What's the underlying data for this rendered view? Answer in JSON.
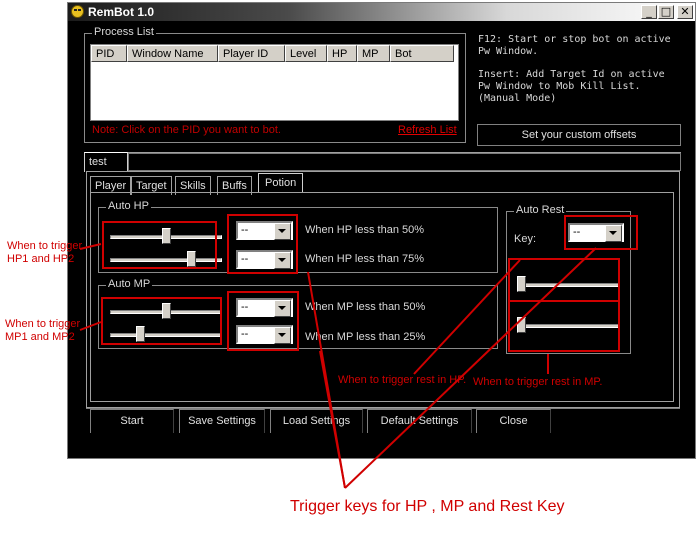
{
  "window": {
    "title": "RemBot 1.0",
    "controls": {
      "minimize": "_",
      "maximize": "□",
      "close": "✕"
    }
  },
  "process_list": {
    "label": "Process List",
    "columns": [
      "PID",
      "Window Name",
      "Player ID",
      "Level",
      "HP",
      "MP",
      "Bot"
    ],
    "note": "Note: Click on the PID you want to bot.",
    "refresh_link": "Refresh List"
  },
  "info": {
    "f12": "F12: Start or stop bot on active\nPw Window.",
    "insert": "Insert: Add Target Id on active\nPw Window to Mob Kill List.\n(Manual Mode)"
  },
  "custom_offsets_button": "Set your custom offsets",
  "profile_tab": "test",
  "tabs": [
    "Player",
    "Target",
    "Skills",
    "Buffs",
    "Potion"
  ],
  "selected_tab": "Potion",
  "auto_hp": {
    "label": "Auto HP",
    "rows": [
      {
        "combo_value": "--",
        "text": "When HP less than 50%",
        "slider": 0.5
      },
      {
        "combo_value": "--",
        "text": "When HP less than 75%",
        "slider": 0.75
      }
    ]
  },
  "auto_mp": {
    "label": "Auto MP",
    "rows": [
      {
        "combo_value": "--",
        "text": "When MP less than 50%",
        "slider": 0.5
      },
      {
        "combo_value": "--",
        "text": "When MP less than 25%",
        "slider": 0.25
      }
    ]
  },
  "auto_rest": {
    "label": "Auto Rest",
    "key_label": "Key:",
    "key_value": "--",
    "hp_slider": 0.0,
    "mp_slider": 0.0
  },
  "bottom_buttons": [
    "Start",
    "Save Settings",
    "Load Settings",
    "Default Settings",
    "Close"
  ],
  "annotations": {
    "hp": "When to trigger\nHP1 and HP2",
    "mp": "When to trigger\nMP1 and MP2",
    "rest_hp": "When to trigger rest in HP.",
    "rest_mp": "When to trigger rest in MP.",
    "keys": "Trigger keys for HP , MP and Rest Key"
  },
  "colors": {
    "annotation": "#d00000",
    "window_bg": "#000000",
    "text": "#d8d8d8"
  }
}
